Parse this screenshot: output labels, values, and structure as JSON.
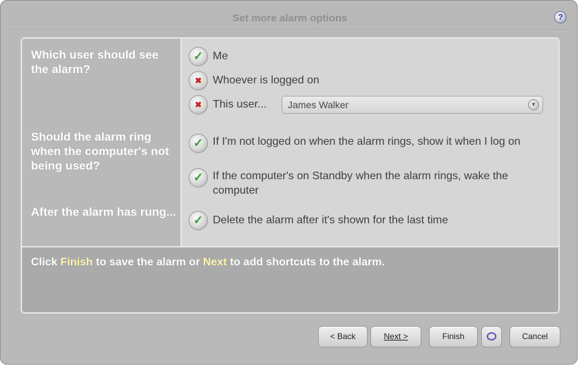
{
  "window": {
    "title": "Set more alarm options",
    "help_label": "?"
  },
  "questions": {
    "user": "Which user should see the alarm?",
    "idle": "Should the alarm ring when the computer's not being used?",
    "after": "After the alarm has rung..."
  },
  "options": {
    "me": {
      "label": "Me",
      "checked": true
    },
    "whoever": {
      "label": "Whoever is logged on",
      "checked": false
    },
    "this_user": {
      "label": "This user...",
      "checked": false
    },
    "show_on_logon": {
      "label": "If I'm not logged on when the alarm rings, show it when I log on",
      "checked": true
    },
    "wake_standby": {
      "label": "If the computer's on Standby when the alarm rings, wake the computer",
      "checked": true
    },
    "delete_after": {
      "label": "Delete the alarm after it's shown for the last time",
      "checked": true
    }
  },
  "user_select": {
    "value": "James Walker"
  },
  "footer": {
    "part1": "Click ",
    "finish_word": "Finish",
    "part2": " to save the alarm or ",
    "next_word": "Next",
    "part3": " to add shortcuts to the alarm."
  },
  "buttons": {
    "back": "< Back",
    "next": "Next >",
    "finish": "Finish",
    "cancel": "Cancel"
  },
  "icons": {
    "help": "help-icon",
    "checked": "check-icon",
    "unchecked": "cross-icon",
    "extra": "speech-bubble-icon"
  },
  "colors": {
    "highlight": "#fff7b0",
    "check": "#3a9a34",
    "cross": "#c4261e"
  }
}
